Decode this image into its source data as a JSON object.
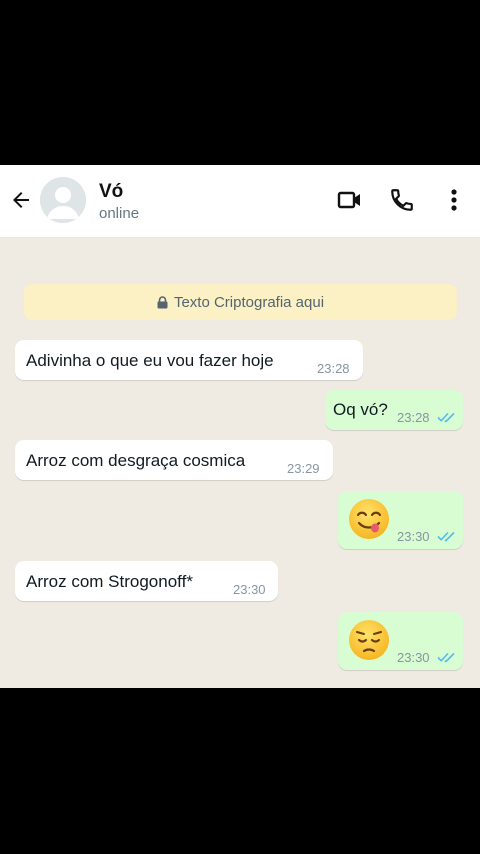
{
  "header": {
    "back_icon": "arrow-left-icon",
    "avatar_icon": "default-avatar-icon",
    "contact_name": "Vó",
    "status": "online",
    "actions": [
      "video-camera-icon",
      "phone-icon",
      "more-vertical-icon"
    ]
  },
  "encryption_notice": {
    "icon": "lock-icon",
    "text": "Texto Criptografia aqui"
  },
  "messages": [
    {
      "direction": "incoming",
      "text": "Adivinha o que eu vou fazer hoje",
      "time": "23:28"
    },
    {
      "direction": "outgoing",
      "text": "Oq vó?",
      "time": "23:28",
      "read": true
    },
    {
      "direction": "incoming",
      "text": "Arroz com desgraça cosmica",
      "time": "23:29"
    },
    {
      "direction": "outgoing",
      "emoji": "face-savoring-food",
      "time": "23:30",
      "read": true
    },
    {
      "direction": "incoming",
      "text": "Arroz com Strogonoff*",
      "time": "23:30"
    },
    {
      "direction": "outgoing",
      "emoji": "pensive-face",
      "time": "23:30",
      "read": true
    }
  ],
  "colors": {
    "chat_background": "#efeae2",
    "header_background": "#ffffff",
    "incoming_bubble": "#ffffff",
    "outgoing_bubble": "#d9fdd3",
    "notice_background": "#fbf1c5",
    "read_ticks": "#53bdeb",
    "timestamp": "#8696a0"
  }
}
